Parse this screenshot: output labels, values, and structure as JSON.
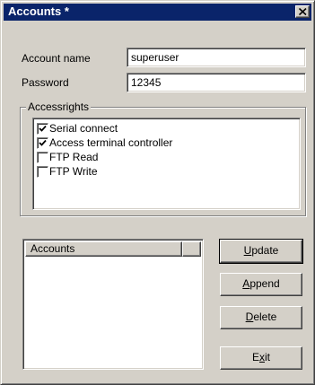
{
  "window": {
    "title": "Accounts *",
    "close_icon": "close-icon"
  },
  "form": {
    "account_name_label": "Account name",
    "account_name_value": "superuser",
    "password_label": "Password",
    "password_value": "12345"
  },
  "access_rights": {
    "group_label": "Accessrights",
    "items": [
      {
        "label": "Serial connect",
        "checked": true
      },
      {
        "label": "Access terminal controller",
        "checked": true
      },
      {
        "label": "FTP Read",
        "checked": false
      },
      {
        "label": "FTP Write",
        "checked": false
      }
    ]
  },
  "accounts_list": {
    "columns": [
      "Accounts",
      ""
    ],
    "rows": []
  },
  "buttons": {
    "update": {
      "pre": "",
      "mnemonic": "U",
      "post": "pdate"
    },
    "append": {
      "pre": "",
      "mnemonic": "A",
      "post": "ppend"
    },
    "delete": {
      "pre": "",
      "mnemonic": "D",
      "post": "elete"
    },
    "exit": {
      "pre": "E",
      "mnemonic": "x",
      "post": "it"
    }
  },
  "colors": {
    "titlebar": "#0a246a",
    "face": "#d4d0c8",
    "field": "#ffffff"
  }
}
